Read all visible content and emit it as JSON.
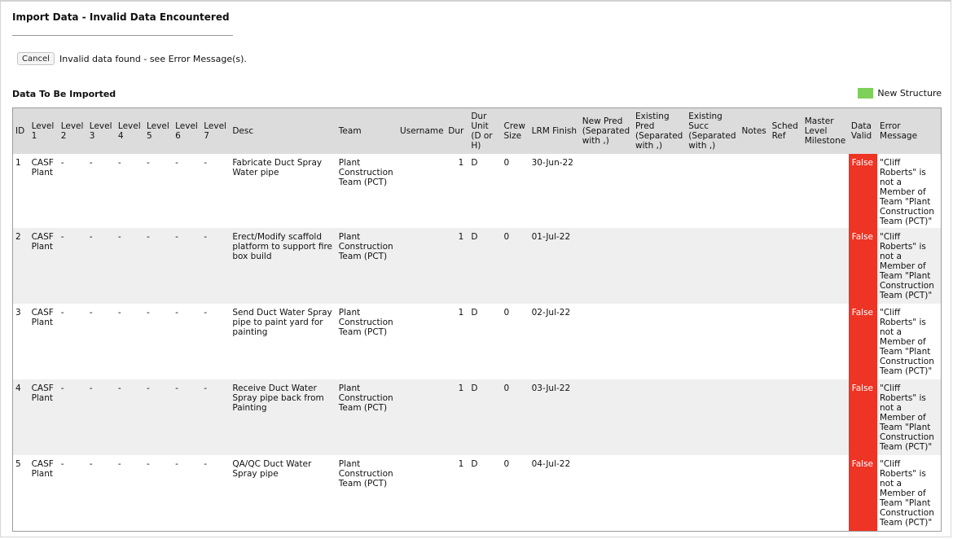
{
  "dialog": {
    "title": "Import Data - Invalid Data Encountered",
    "cancel_label": "Cancel",
    "status_message": "Invalid data found - see Error Message(s)."
  },
  "section": {
    "title": "Data To Be Imported",
    "legend_label": "New Structure",
    "legend_color": "#7fd05a"
  },
  "colors": {
    "invalid_cell": "#ee3424",
    "header_bg": "#dcdcdc",
    "alt_row_bg": "#efefef"
  },
  "table": {
    "headers": {
      "id": "ID",
      "level1": "Level 1",
      "level2": "Level 2",
      "level3": "Level 3",
      "level4": "Level 4",
      "level5": "Level 5",
      "level6": "Level 6",
      "level7": "Level 7",
      "desc": "Desc",
      "team": "Team",
      "username": "Username",
      "dur": "Dur",
      "dur_unit": "Dur Unit (D or H)",
      "crew_size": "Crew Size",
      "lrm_finish": "LRM Finish",
      "new_pred": "New Pred (Separated with ,)",
      "existing_pred": "Existing Pred (Separated with ,)",
      "existing_succ": "Existing Succ (Separated with ,)",
      "notes": "Notes",
      "sched_ref": "Sched Ref",
      "master_level_milestone": "Master Level Milestone",
      "data_valid": "Data Valid",
      "error_message": "Error Message"
    },
    "rows": [
      {
        "id": "1",
        "level1": "CASF Plant",
        "level2": "-",
        "level3": "-",
        "level4": "-",
        "level5": "-",
        "level6": "-",
        "level7": "-",
        "desc": "Fabricate Duct Spray Water pipe",
        "team": "Plant Construction Team (PCT)",
        "username": "",
        "dur": "1",
        "dur_unit": "D",
        "crew_size": "0",
        "lrm_finish": "30-Jun-22",
        "new_pred": "",
        "existing_pred": "",
        "existing_succ": "",
        "notes": "",
        "sched_ref": "",
        "master_level_milestone": "",
        "data_valid": "False",
        "error_message": "\"Cliff Roberts\" is not a Member of Team \"Plant Construction Team (PCT)\""
      },
      {
        "id": "2",
        "level1": "CASF Plant",
        "level2": "-",
        "level3": "-",
        "level4": "-",
        "level5": "-",
        "level6": "-",
        "level7": "-",
        "desc": "Erect/Modify scaffold platform to support fire box build",
        "team": "Plant Construction Team (PCT)",
        "username": "",
        "dur": "1",
        "dur_unit": "D",
        "crew_size": "0",
        "lrm_finish": "01-Jul-22",
        "new_pred": "",
        "existing_pred": "",
        "existing_succ": "",
        "notes": "",
        "sched_ref": "",
        "master_level_milestone": "",
        "data_valid": "False",
        "error_message": "\"Cliff Roberts\" is not a Member of Team \"Plant Construction Team (PCT)\""
      },
      {
        "id": "3",
        "level1": "CASF Plant",
        "level2": "-",
        "level3": "-",
        "level4": "-",
        "level5": "-",
        "level6": "-",
        "level7": "-",
        "desc": "Send Duct Water Spray pipe to paint yard for painting",
        "team": "Plant Construction Team (PCT)",
        "username": "",
        "dur": "1",
        "dur_unit": "D",
        "crew_size": "0",
        "lrm_finish": "02-Jul-22",
        "new_pred": "",
        "existing_pred": "",
        "existing_succ": "",
        "notes": "",
        "sched_ref": "",
        "master_level_milestone": "",
        "data_valid": "False",
        "error_message": "\"Cliff Roberts\" is not a Member of Team \"Plant Construction Team (PCT)\""
      },
      {
        "id": "4",
        "level1": "CASF Plant",
        "level2": "-",
        "level3": "-",
        "level4": "-",
        "level5": "-",
        "level6": "-",
        "level7": "-",
        "desc": "Receive Duct Water Spray pipe back from Painting",
        "team": "Plant Construction Team (PCT)",
        "username": "",
        "dur": "1",
        "dur_unit": "D",
        "crew_size": "0",
        "lrm_finish": "03-Jul-22",
        "new_pred": "",
        "existing_pred": "",
        "existing_succ": "",
        "notes": "",
        "sched_ref": "",
        "master_level_milestone": "",
        "data_valid": "False",
        "error_message": "\"Cliff Roberts\" is not a Member of Team \"Plant Construction Team (PCT)\""
      },
      {
        "id": "5",
        "level1": "CASF Plant",
        "level2": "-",
        "level3": "-",
        "level4": "-",
        "level5": "-",
        "level6": "-",
        "level7": "-",
        "desc": "QA/QC Duct Water Spray pipe",
        "team": "Plant Construction Team (PCT)",
        "username": "",
        "dur": "1",
        "dur_unit": "D",
        "crew_size": "0",
        "lrm_finish": "04-Jul-22",
        "new_pred": "",
        "existing_pred": "",
        "existing_succ": "",
        "notes": "",
        "sched_ref": "",
        "master_level_milestone": "",
        "data_valid": "False",
        "error_message": "\"Cliff Roberts\" is not a Member of Team \"Plant Construction Team (PCT)\""
      }
    ]
  }
}
